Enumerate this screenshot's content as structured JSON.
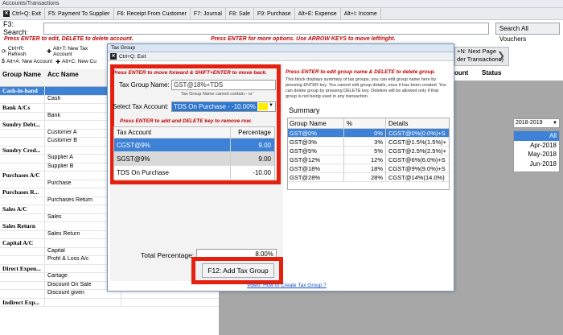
{
  "window": {
    "title": "Accounts/Transactions"
  },
  "toolbar": {
    "exit": "Ctrl+Q: Exit",
    "items": [
      "F5: Payment To Supplier",
      "F6: Receipt From Customer",
      "F7: Journal",
      "F8: Sale",
      "F9: Purchase",
      "Alt+E: Expense",
      "Alt+I: Income"
    ]
  },
  "search": {
    "label": "F3: Search:",
    "value": "",
    "button": "Search All Vouchers"
  },
  "hints": {
    "left": "Press ENTER to edit, DELETE to delete account.",
    "right": "Press ENTER for more options. Use ARROW KEYS to move left/right."
  },
  "acc_toolbar": {
    "refresh": "Ctrl+R: Refresh",
    "new_tax": "Alt+T: New Tax Account",
    "new_account": "Alt+A: New Account",
    "new_c": "Alt+C: New Cu"
  },
  "grid": {
    "headers": [
      "Group Name",
      "Acc Name"
    ],
    "rows": [
      {
        "group": "Cash-in-hand",
        "acc": "",
        "type": "group",
        "sel": true
      },
      {
        "group": "",
        "acc": "Cash",
        "type": "item"
      },
      {
        "group": "Bank A/Cs",
        "acc": "",
        "type": "group"
      },
      {
        "group": "",
        "acc": "Bank",
        "type": "item"
      },
      {
        "group": "Sundry Debt...",
        "acc": "",
        "type": "group"
      },
      {
        "group": "",
        "acc": "Customer A",
        "type": "item"
      },
      {
        "group": "",
        "acc": "Customer B",
        "type": "item"
      },
      {
        "group": "Sundry Cred...",
        "acc": "",
        "type": "group"
      },
      {
        "group": "",
        "acc": "Supplier A",
        "type": "item"
      },
      {
        "group": "",
        "acc": "Supplier B",
        "type": "item"
      },
      {
        "group": "Purchases A/C",
        "acc": "",
        "type": "group"
      },
      {
        "group": "",
        "acc": "Purchase",
        "type": "item"
      },
      {
        "group": "Purchases R...",
        "acc": "",
        "type": "group"
      },
      {
        "group": "",
        "acc": "Purchases Return",
        "type": "item"
      },
      {
        "group": "Sales A/C",
        "acc": "",
        "type": "group"
      },
      {
        "group": "",
        "acc": "Sales",
        "type": "item"
      },
      {
        "group": "Sales Return",
        "acc": "",
        "type": "group"
      },
      {
        "group": "",
        "acc": "Sales Return",
        "type": "item"
      },
      {
        "group": "Capital A/C",
        "acc": "",
        "type": "group"
      },
      {
        "group": "",
        "acc": "Capital",
        "type": "item"
      },
      {
        "group": "",
        "acc": "Profit & Loss A/c",
        "type": "item"
      },
      {
        "group": "Direct Expen...",
        "acc": "",
        "type": "group"
      },
      {
        "group": "",
        "acc": "Cartage",
        "type": "item"
      },
      {
        "group": "",
        "acc": "Discount On Sale",
        "type": "item"
      },
      {
        "group": "",
        "acc": "Discount given",
        "type": "item"
      },
      {
        "group": "Indirect Exp...",
        "acc": "",
        "type": "group"
      }
    ]
  },
  "right_headers": {
    "account": "ount",
    "status": "Status"
  },
  "next_page": {
    "line1": "+N: Next Page",
    "line2": "der Transactions)"
  },
  "year": {
    "selected": "2018-2019",
    "months": [
      "All",
      "Apr-2018",
      "May-2018",
      "Jun-2018"
    ]
  },
  "dialog": {
    "title": "Tax Group",
    "exit": "Ctrl+Q: Exit",
    "hint_top": "Press ENTER to move forward & SHIFT+ENTER to move back.",
    "tax_group_label": "Tax Group Name:",
    "tax_group_value": "GST@18%+TDS",
    "tax_group_note": "Tax Group Name cannot contain - or '",
    "select_tax_label": "Select Tax Account:",
    "select_tax_value": "TDS On Purchase - -10.00%",
    "hint_table": "Press ENTER to add and DELETE key to remove row.",
    "tax_table": {
      "headers": [
        "Tax Account",
        "Percentage"
      ],
      "rows": [
        {
          "account": "CGST@9%",
          "pct": "9.00"
        },
        {
          "account": "SGST@9%",
          "pct": "9.00"
        },
        {
          "account": "TDS On Purchase",
          "pct": "-10.00"
        }
      ]
    },
    "total_label": "Total Percentage:",
    "total_value": "8.00%",
    "add_button": "F12: Add Tax Group",
    "video_link": "Video: How to Create Tax Group ?",
    "right_hint": "Press ENTER to edit group name & DELETE to delete group.",
    "right_desc": "This block displays summary of tax groups, you can edit group name here by pressing ENTER key. You cannot edit group details, once it has been created. You can delete group by pressing DELETE key. Deletion will be allowed only if that group is not being used in any transaction.",
    "summary_title": "Summary",
    "summary": {
      "headers": [
        "Group Name",
        "%",
        "Details"
      ],
      "rows": [
        {
          "name": "GST@0%",
          "pct": "0%",
          "details": "CGST@0%(0.0%)+S"
        },
        {
          "name": "GST@3%",
          "pct": "3%",
          "details": "CGST@1.5%(1.5%)+"
        },
        {
          "name": "GST@5%",
          "pct": "5%",
          "details": "CGST@2.5%(2.5%)+"
        },
        {
          "name": "GST@12%",
          "pct": "12%",
          "details": "CGST@6%(6.0%)+S"
        },
        {
          "name": "GST@18%",
          "pct": "18%",
          "details": "CGST@9%(9.0%)+S"
        },
        {
          "name": "GST@28%",
          "pct": "28%",
          "details": "CGST@14%(14.0%)"
        }
      ]
    }
  }
}
